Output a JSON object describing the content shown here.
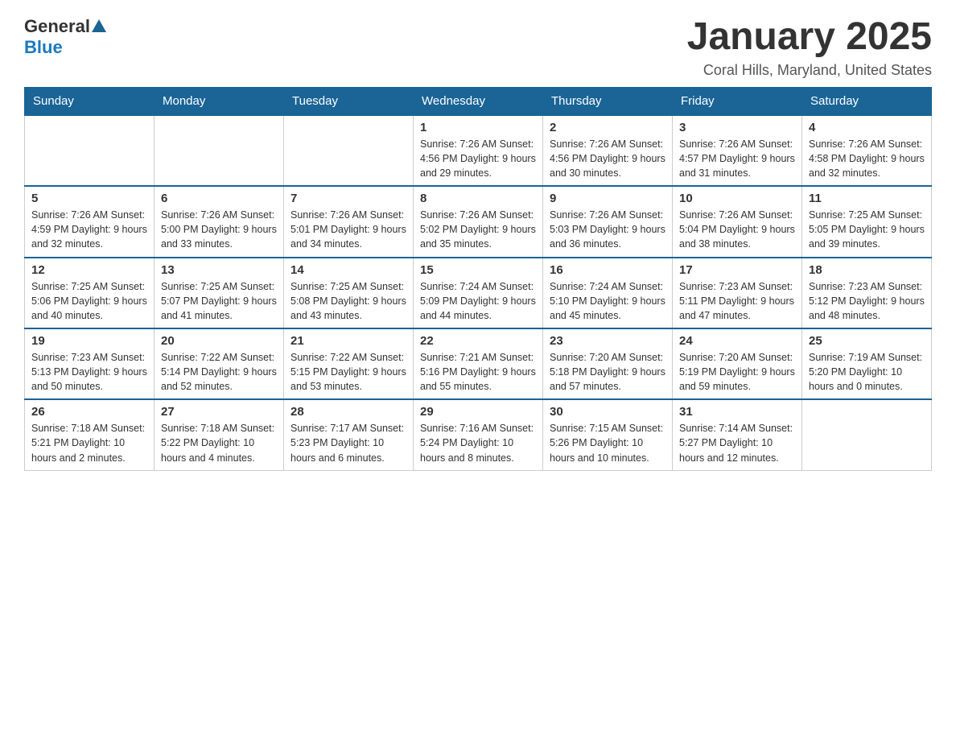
{
  "header": {
    "logo": {
      "general": "General",
      "blue": "Blue"
    },
    "title": "January 2025",
    "location": "Coral Hills, Maryland, United States"
  },
  "calendar": {
    "days_of_week": [
      "Sunday",
      "Monday",
      "Tuesday",
      "Wednesday",
      "Thursday",
      "Friday",
      "Saturday"
    ],
    "weeks": [
      {
        "days": [
          {
            "number": "",
            "info": ""
          },
          {
            "number": "",
            "info": ""
          },
          {
            "number": "",
            "info": ""
          },
          {
            "number": "1",
            "info": "Sunrise: 7:26 AM\nSunset: 4:56 PM\nDaylight: 9 hours\nand 29 minutes."
          },
          {
            "number": "2",
            "info": "Sunrise: 7:26 AM\nSunset: 4:56 PM\nDaylight: 9 hours\nand 30 minutes."
          },
          {
            "number": "3",
            "info": "Sunrise: 7:26 AM\nSunset: 4:57 PM\nDaylight: 9 hours\nand 31 minutes."
          },
          {
            "number": "4",
            "info": "Sunrise: 7:26 AM\nSunset: 4:58 PM\nDaylight: 9 hours\nand 32 minutes."
          }
        ]
      },
      {
        "days": [
          {
            "number": "5",
            "info": "Sunrise: 7:26 AM\nSunset: 4:59 PM\nDaylight: 9 hours\nand 32 minutes."
          },
          {
            "number": "6",
            "info": "Sunrise: 7:26 AM\nSunset: 5:00 PM\nDaylight: 9 hours\nand 33 minutes."
          },
          {
            "number": "7",
            "info": "Sunrise: 7:26 AM\nSunset: 5:01 PM\nDaylight: 9 hours\nand 34 minutes."
          },
          {
            "number": "8",
            "info": "Sunrise: 7:26 AM\nSunset: 5:02 PM\nDaylight: 9 hours\nand 35 minutes."
          },
          {
            "number": "9",
            "info": "Sunrise: 7:26 AM\nSunset: 5:03 PM\nDaylight: 9 hours\nand 36 minutes."
          },
          {
            "number": "10",
            "info": "Sunrise: 7:26 AM\nSunset: 5:04 PM\nDaylight: 9 hours\nand 38 minutes."
          },
          {
            "number": "11",
            "info": "Sunrise: 7:25 AM\nSunset: 5:05 PM\nDaylight: 9 hours\nand 39 minutes."
          }
        ]
      },
      {
        "days": [
          {
            "number": "12",
            "info": "Sunrise: 7:25 AM\nSunset: 5:06 PM\nDaylight: 9 hours\nand 40 minutes."
          },
          {
            "number": "13",
            "info": "Sunrise: 7:25 AM\nSunset: 5:07 PM\nDaylight: 9 hours\nand 41 minutes."
          },
          {
            "number": "14",
            "info": "Sunrise: 7:25 AM\nSunset: 5:08 PM\nDaylight: 9 hours\nand 43 minutes."
          },
          {
            "number": "15",
            "info": "Sunrise: 7:24 AM\nSunset: 5:09 PM\nDaylight: 9 hours\nand 44 minutes."
          },
          {
            "number": "16",
            "info": "Sunrise: 7:24 AM\nSunset: 5:10 PM\nDaylight: 9 hours\nand 45 minutes."
          },
          {
            "number": "17",
            "info": "Sunrise: 7:23 AM\nSunset: 5:11 PM\nDaylight: 9 hours\nand 47 minutes."
          },
          {
            "number": "18",
            "info": "Sunrise: 7:23 AM\nSunset: 5:12 PM\nDaylight: 9 hours\nand 48 minutes."
          }
        ]
      },
      {
        "days": [
          {
            "number": "19",
            "info": "Sunrise: 7:23 AM\nSunset: 5:13 PM\nDaylight: 9 hours\nand 50 minutes."
          },
          {
            "number": "20",
            "info": "Sunrise: 7:22 AM\nSunset: 5:14 PM\nDaylight: 9 hours\nand 52 minutes."
          },
          {
            "number": "21",
            "info": "Sunrise: 7:22 AM\nSunset: 5:15 PM\nDaylight: 9 hours\nand 53 minutes."
          },
          {
            "number": "22",
            "info": "Sunrise: 7:21 AM\nSunset: 5:16 PM\nDaylight: 9 hours\nand 55 minutes."
          },
          {
            "number": "23",
            "info": "Sunrise: 7:20 AM\nSunset: 5:18 PM\nDaylight: 9 hours\nand 57 minutes."
          },
          {
            "number": "24",
            "info": "Sunrise: 7:20 AM\nSunset: 5:19 PM\nDaylight: 9 hours\nand 59 minutes."
          },
          {
            "number": "25",
            "info": "Sunrise: 7:19 AM\nSunset: 5:20 PM\nDaylight: 10 hours\nand 0 minutes."
          }
        ]
      },
      {
        "days": [
          {
            "number": "26",
            "info": "Sunrise: 7:18 AM\nSunset: 5:21 PM\nDaylight: 10 hours\nand 2 minutes."
          },
          {
            "number": "27",
            "info": "Sunrise: 7:18 AM\nSunset: 5:22 PM\nDaylight: 10 hours\nand 4 minutes."
          },
          {
            "number": "28",
            "info": "Sunrise: 7:17 AM\nSunset: 5:23 PM\nDaylight: 10 hours\nand 6 minutes."
          },
          {
            "number": "29",
            "info": "Sunrise: 7:16 AM\nSunset: 5:24 PM\nDaylight: 10 hours\nand 8 minutes."
          },
          {
            "number": "30",
            "info": "Sunrise: 7:15 AM\nSunset: 5:26 PM\nDaylight: 10 hours\nand 10 minutes."
          },
          {
            "number": "31",
            "info": "Sunrise: 7:14 AM\nSunset: 5:27 PM\nDaylight: 10 hours\nand 12 minutes."
          },
          {
            "number": "",
            "info": ""
          }
        ]
      }
    ]
  }
}
